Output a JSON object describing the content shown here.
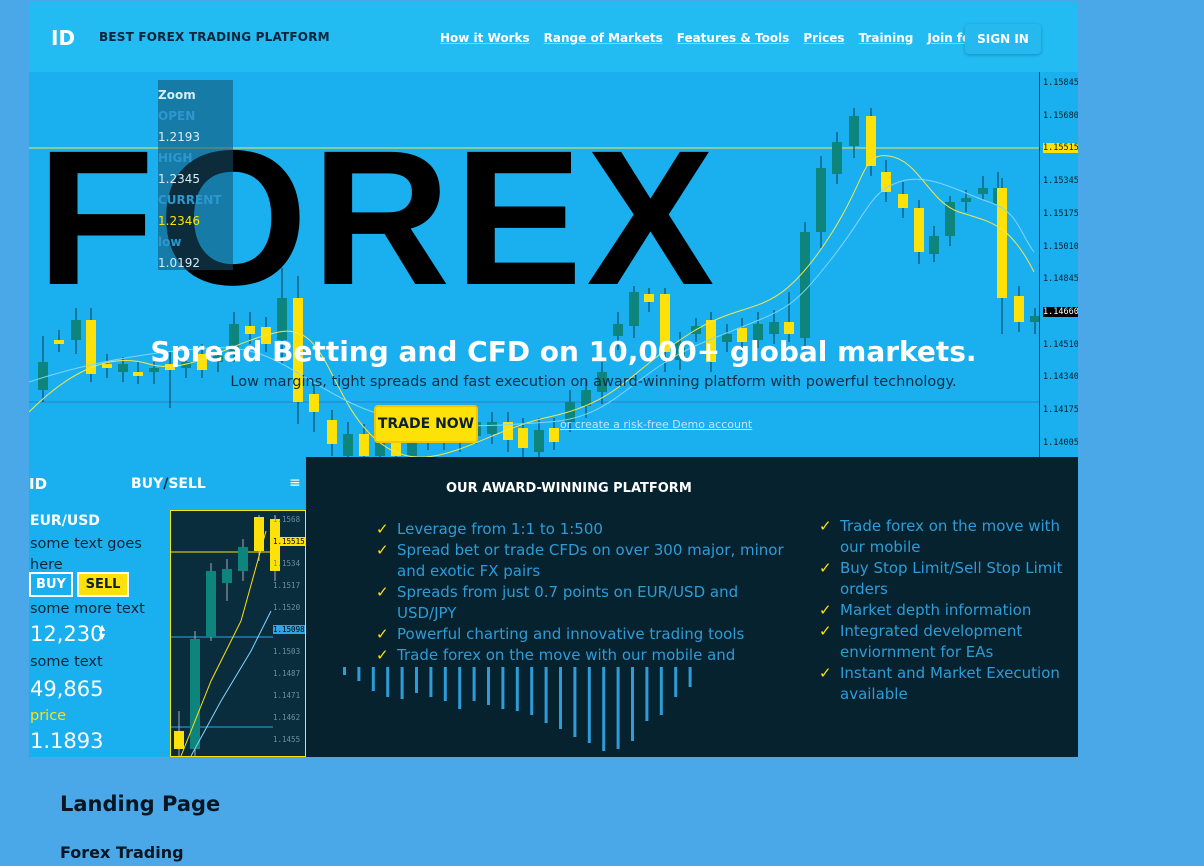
{
  "nav": {
    "logo": "ID",
    "tagline": "BEST FOREX TRADING PLATFORM",
    "links": [
      "How it Works",
      "Range of Markets",
      "Features & Tools",
      "Prices",
      "Training",
      "Join for free"
    ],
    "signin": "SIGN IN"
  },
  "hero": {
    "big_title": "FOREX",
    "headline": "Spread Betting and CFD on 10,000+ global markets.",
    "subheadline": "Low margins, tight spreads and fast execution on award-winning platform with powerful technology.",
    "cta": "TRADE NOW",
    "demo_link": "or create a risk-free Demo account",
    "zoom_panel": {
      "zoom": "Zoom",
      "open_label": "OPEN",
      "open_value": "1.2193",
      "high_label": "HIGH",
      "high_value": "1.2345",
      "current_label": "CURRENT",
      "current_value": "1.2346",
      "low_label": "low",
      "low_value": "1.0192"
    },
    "price_axis": [
      "1.15845",
      "1.15680",
      "1.15515",
      "1.15345",
      "1.15175",
      "1.15010",
      "1.14845",
      "1.14660",
      "1.14510",
      "1.14340",
      "1.14175",
      "1.14005"
    ]
  },
  "widget": {
    "logo": "ID",
    "buy_word": "BUY",
    "slash": "/",
    "sell_word": "SELL",
    "menu_icon": "≡",
    "pair": "EUR/USD",
    "text1": "some text goes here",
    "buy_button": "BUY",
    "sell_button": "SELL",
    "text2": "some more text",
    "quantity": "12,230",
    "text3": "some text",
    "value1": "49,865",
    "text4": "price",
    "value2": "1.1893",
    "chart_axis": [
      "1.1568",
      "1.15515",
      "1.1534",
      "1.1517",
      "1.1520",
      "1.15098",
      "1.1503",
      "1.1487",
      "1.1471",
      "1.1462",
      "1.1455"
    ]
  },
  "platform": {
    "title": "OUR AWARD-WINNING PLATFORM",
    "features_left": [
      "Leverage from 1:1 to 1:500",
      "Spread bet or trade CFDs on over 300 major, minor and exotic FX pairs",
      "Spreads from just 0.7 points on EUR/USD and USD/JPY",
      "Powerful charting and innovative trading tools",
      "Trade forex on the move with our mobile and"
    ],
    "features_right": [
      "Trade forex on the move with our mobile",
      "Buy Stop Limit/Sell Stop Limit orders",
      "Market depth information",
      "Integrated development enviornment for EAs",
      "Instant and Market Execution available"
    ],
    "check_icon": "✓"
  },
  "page": {
    "heading": "Landing Page",
    "subheading": "Forex Trading"
  },
  "colors": {
    "hero_bg": "#1ab0ef",
    "accent_yellow": "#ffe10a",
    "candle_teal": "#0b8a7e",
    "dark_section": "#06222f",
    "page_bg": "#4aa8e8"
  }
}
